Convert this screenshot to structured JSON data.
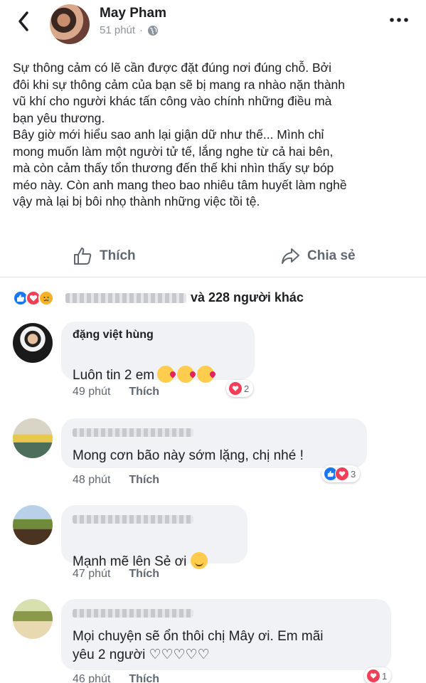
{
  "post": {
    "author": "May Pham",
    "time": "51 phút",
    "dot": "·",
    "text": "Sự thông cảm có lẽ cần được đặt đúng nơi đúng chỗ. Bởi\nđôi khi sự thông cảm của bạn sẽ bị mang ra nhào nặn thành\nvũ khí cho người khác tấn công vào chính những điều mà\nbạn yêu thương.\nBây giờ mới hiểu sao anh lại giận dữ như thế... Mình chỉ\nmong muốn làm một người tử tế, lắng nghe từ cả hai bên,\nmà còn cảm thấy tổn thương đến thế khi nhìn thấy sự bóp\nméo này. Còn anh mang theo bao nhiêu tâm huyết làm nghề\nvậy mà lại bị bôi nhọ thành những việc tồi tệ."
  },
  "actions": {
    "like_label": "Thích",
    "share_label": "Chia sẻ"
  },
  "reactions": {
    "others_text": "và 228 người khác"
  },
  "comments": [
    {
      "name": "đặng việt hùng",
      "text": "Luôn tin 2 em",
      "time": "49 phút",
      "like": "Thích",
      "react_count": "2"
    },
    {
      "name": "",
      "text": "Mong cơn bão này sớm lặng, chị nhé !",
      "time": "48 phút",
      "like": "Thích",
      "react_count": "3"
    },
    {
      "name": "",
      "text": "Mạnh mẽ lên Sẻ ơi",
      "time": "47 phút",
      "like": "Thích",
      "react_count": ""
    },
    {
      "name": "",
      "text": "Mọi chuyện sẽ ổn thôi chị Mây ơi. Em mãi\nyêu 2 người ♡♡♡♡♡",
      "time": "46 phút",
      "like": "Thích",
      "react_count": "1"
    }
  ],
  "colors": {
    "accent": "#1877f2",
    "love": "#f33e58",
    "bubble": "#f0f2f5",
    "muted": "#606770"
  },
  "icons": [
    "back-icon",
    "globe-icon",
    "more-icon",
    "like-icon",
    "share-icon",
    "kiss-emoji-icon",
    "smile-emoji-icon"
  ]
}
